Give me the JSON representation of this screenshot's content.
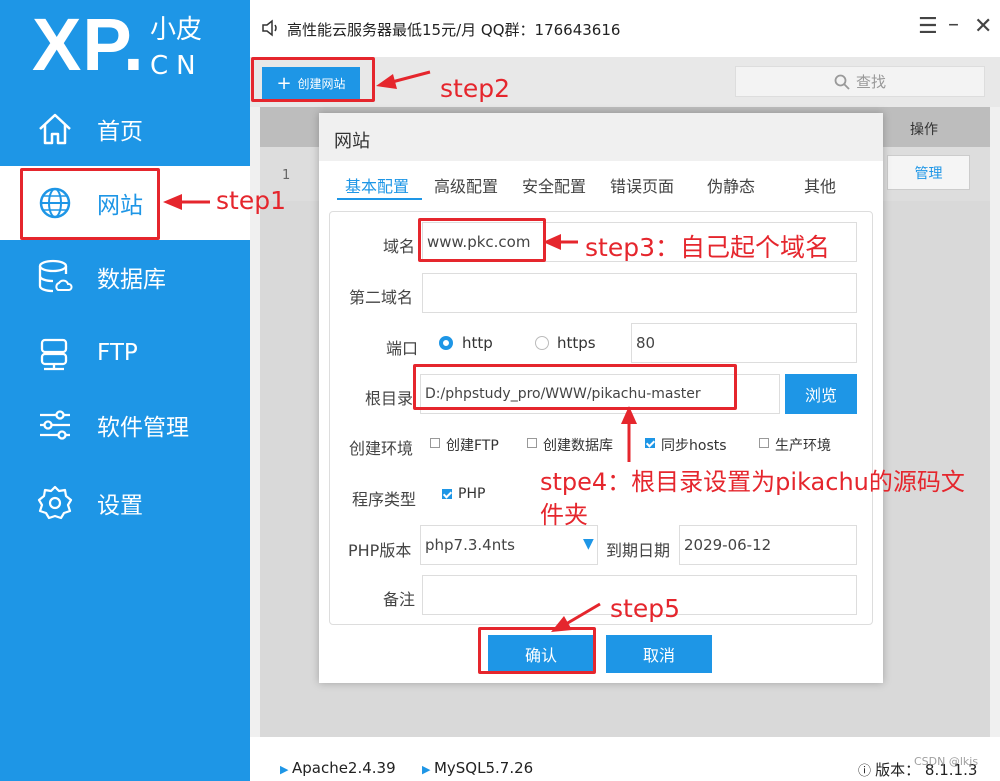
{
  "app": {
    "logo_main": "XP.",
    "logo_cn_top": "小皮",
    "logo_cn_bottom": "CN",
    "window_title": "高性能云服务器最低15元/月  QQ群：176643616"
  },
  "sidebar": {
    "items": [
      {
        "label": "首页",
        "icon": "home-icon"
      },
      {
        "label": "网站",
        "icon": "globe-icon",
        "active": true
      },
      {
        "label": "数据库",
        "icon": "database-icon"
      },
      {
        "label": "FTP",
        "icon": "server-icon"
      },
      {
        "label": "软件管理",
        "icon": "sliders-icon"
      },
      {
        "label": "设置",
        "icon": "gear-icon"
      }
    ]
  },
  "toolbar": {
    "create_label": "创建网站",
    "search_label": "查找"
  },
  "grid": {
    "op_header": "操作",
    "row_num": "1",
    "manage_label": "管理"
  },
  "status": {
    "apache": "Apache2.4.39",
    "mysql": "MySQL5.7.26",
    "version": "版本： 8.1.1.3",
    "watermark": "CSDN @lkjs"
  },
  "dialog": {
    "title": "网站",
    "tabs": [
      "基本配置",
      "高级配置",
      "安全配置",
      "错误页面",
      "伪静态",
      "其他"
    ],
    "domain_label": "域名",
    "domain_value": "www.pkc.com",
    "domain2_label": "第二域名",
    "domain2_value": "",
    "port_label": "端口",
    "http_label": "http",
    "https_label": "https",
    "port_value": "80",
    "root_label": "根目录",
    "root_value": "D:/phpstudy_pro/WWW/pikachu-master",
    "browse_label": "浏览",
    "env_label": "创建环境",
    "env_options": [
      {
        "label": "创建FTP",
        "checked": false
      },
      {
        "label": "创建数据库",
        "checked": false
      },
      {
        "label": "同步hosts",
        "checked": true
      },
      {
        "label": "生产环境",
        "checked": false
      }
    ],
    "ptype_label": "程序类型",
    "ptype_value": "PHP",
    "php_label": "PHP版本",
    "php_value": "php7.3.4nts",
    "expire_label": "到期日期",
    "expire_value": "2029-06-12",
    "note_label": "备注",
    "note_value": "",
    "ok_label": "确认",
    "cancel_label": "取消"
  },
  "annotations": {
    "step1": "step1",
    "step2": "step2",
    "step3": "step3：自己起个域名",
    "step4_line1": "stpe4：根目录设置为pikachu的源码文",
    "step4_line2": "件夹",
    "step5": "step5",
    "color": "#e5262d"
  }
}
